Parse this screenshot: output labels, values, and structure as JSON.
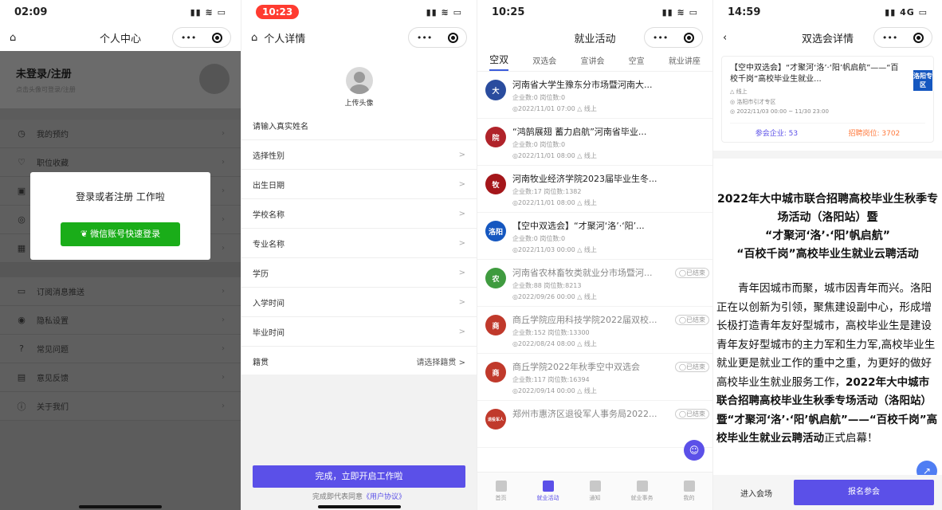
{
  "p1": {
    "time": "02:09",
    "title": "个人中心",
    "login_title": "未登录/注册",
    "login_sub": "点击头像可登录/注册",
    "menu1": [
      {
        "label": "我的预约",
        "icon": "clock-icon"
      },
      {
        "label": "职位收藏",
        "icon": "heart-icon"
      },
      {
        "label": "",
        "icon": "briefcase-icon"
      },
      {
        "label": "",
        "icon": "eye-icon"
      },
      {
        "label": "",
        "icon": "grid-icon"
      }
    ],
    "menu2": [
      {
        "label": "订阅消息推送",
        "icon": "message-icon"
      },
      {
        "label": "隐私设置",
        "icon": "lock-icon"
      },
      {
        "label": "常见问题",
        "icon": "question-icon"
      },
      {
        "label": "意见反馈",
        "icon": "feedback-icon"
      },
      {
        "label": "关于我们",
        "icon": "info-icon"
      }
    ],
    "modal_text": "登录或者注册 工作啦",
    "modal_button": "微信账号快速登录"
  },
  "p2": {
    "time": "10:23",
    "title": "个人详情",
    "upload": "上传头像",
    "fields": [
      {
        "label": "请输入真实姓名",
        "value": ""
      },
      {
        "label": "选择性别",
        "value": ">"
      },
      {
        "label": "出生日期",
        "value": ">"
      },
      {
        "label": "学校名称",
        "value": ">"
      },
      {
        "label": "专业名称",
        "value": ">"
      },
      {
        "label": "学历",
        "value": ">"
      },
      {
        "label": "入学时间",
        "value": ">"
      },
      {
        "label": "毕业时间",
        "value": ">"
      },
      {
        "label": "籍贯",
        "value": "请选择籍贯 >"
      }
    ],
    "submit": "完成，立即开启工作啦",
    "agree_prefix": "完成即代表同意",
    "agree_link": "《用户协议》"
  },
  "p3": {
    "time": "10:25",
    "title": "就业活动",
    "tabs": [
      "空双",
      "双选会",
      "宣讲会",
      "空宣",
      "就业讲座"
    ],
    "activities": [
      {
        "title": "河南省大学生豫东分市场暨河南大...",
        "m1": "企业数:0  岗位数:0",
        "m2": "◎2022/11/01 07:00   △ 线上",
        "tag": "",
        "color": "#2a4c9e",
        "logo": "大"
      },
      {
        "title": "“鸿鹄展翅 蓄力启航”河南省毕业...",
        "m1": "企业数:0  岗位数:0",
        "m2": "◎2022/11/01 08:00   △ 线上",
        "tag": "",
        "color": "#b0232a",
        "logo": "院"
      },
      {
        "title": "河南牧业经济学院2023届毕业生冬...",
        "m1": "企业数:17  岗位数:1382",
        "m2": "◎2022/11/01 08:00   △ 线上",
        "tag": "",
        "color": "#a4161a",
        "logo": "牧"
      },
      {
        "title": "【空中双选会】“才聚河‘洛’·‘阳’...",
        "m1": "企业数:0  岗位数:0",
        "m2": "◎2022/11/03 00:00   △ 线上",
        "tag": "",
        "color": "#1557c0",
        "logo": "洛阳"
      },
      {
        "title": "河南省农林畜牧类就业分市场暨河...",
        "m1": "企业数:88  岗位数:8213",
        "m2": "◎2022/09/26 00:00   △ 线上",
        "tag": "◯已结束",
        "color": "#3f9b3f",
        "logo": "农"
      },
      {
        "title": "商丘学院应用科技学院2022届双校...",
        "m1": "企业数:152  岗位数:13300",
        "m2": "◎2022/08/24 08:00   △ 线上",
        "tag": "◯已结束",
        "color": "#c0392b",
        "logo": "商"
      },
      {
        "title": "商丘学院2022年秋季空中双选会",
        "m1": "企业数:117  岗位数:16394",
        "m2": "◎2022/09/14 00:00   △ 线上",
        "tag": "◯已结束",
        "color": "#c0392b",
        "logo": "商"
      },
      {
        "title": "郑州市惠济区退役军人事务局2022...",
        "m1": "",
        "m2": "",
        "tag": "◯已结束",
        "color": "#c0392b",
        "logo": "退役军人"
      }
    ],
    "bottom_nav": [
      "首页",
      "就业活动",
      "通知",
      "就业事务",
      "我的"
    ],
    "bottom_active": 1
  },
  "p4": {
    "time": "14:59",
    "title": "双选会详情",
    "card_title": "【空中双选会】“才聚河‘洛’·‘阳’帆启航”——“百校千岗”高校毕业生就业...",
    "badge": "洛阳专区",
    "meta1": "△ 线上",
    "meta2": "◎ 洛阳市引才专区",
    "meta3": "◎ 2022/11/03 00:00 ~ 11/30 23:00",
    "companies": "参会企业: 53",
    "positions": "招聘岗位: 3702",
    "heading1": "2022年大中城市联合招聘高校毕业生秋季专场活动（洛阳站）暨",
    "heading2": "“才聚河‘洛’·‘阳’帆启航”",
    "heading3": "“百校千岗”高校毕业生就业云聘活动",
    "para_plain": "青年因城市而聚，城市因青年而兴。洛阳正在以创新为引领，聚焦建设副中心，形成增长极打造青年友好型城市，高校毕业生是建设青年友好型城市的主力军和生力军,高校毕业生就业更是就业工作的重中之重，为更好的做好高校毕业生就业服务工作，",
    "para_bold": "2022年大中城市联合招聘高校毕业生秋季专场活动（洛阳站）暨“才聚河‘洛’·‘阳’帆启航”——“百校千岗”高校毕业生就业云聘活动",
    "para_end": "正式启幕！",
    "enter": "进入会场",
    "register": "报名参会"
  }
}
